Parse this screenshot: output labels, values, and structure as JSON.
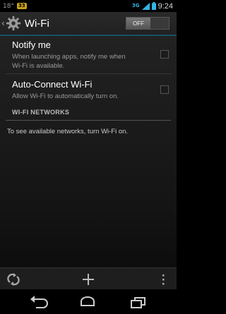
{
  "status_bar": {
    "temperature": "18°",
    "notification_badge": "33",
    "network_type": "3G",
    "time": "9:24"
  },
  "action_bar": {
    "title": "Wi-Fi",
    "toggle_label": "OFF"
  },
  "preferences": [
    {
      "title": "Notify me",
      "summary": "When launching apps, notify me when Wi-Fi is available.",
      "checked": false
    },
    {
      "title": "Auto-Connect Wi-Fi",
      "summary": "Allow Wi-Fi to automatically turn on.",
      "checked": false
    }
  ],
  "networks_section": {
    "header": "WI-FI NETWORKS",
    "empty_message": "To see available networks, turn Wi-Fi on."
  },
  "bottom_bar": {
    "icons": [
      "scan-icon",
      "add-icon",
      "overflow-menu-icon"
    ]
  },
  "nav_bar": {
    "icons": [
      "back-icon",
      "home-icon",
      "recents-icon"
    ]
  },
  "colors": {
    "accent": "#33b5e5",
    "background": "#000000",
    "badge": "#c9a21c"
  }
}
